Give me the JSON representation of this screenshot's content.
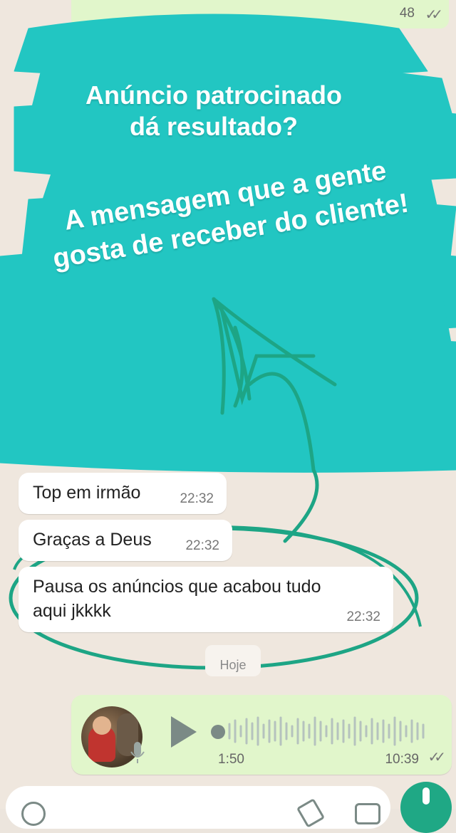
{
  "overlay": {
    "title_line1": "Anúncio patrocinado",
    "title_line2": "dá resultado?",
    "caption_line1": "A mensagem que a gente",
    "caption_line2": "gosta de receber do cliente!"
  },
  "top_message": {
    "time": "48",
    "ticks": "✓✓"
  },
  "messages": [
    {
      "text": "Top em irmão",
      "time": "22:32"
    },
    {
      "text": "Graças a Deus",
      "time": "22:32"
    },
    {
      "text_line1": "Pausa os anúncios que acabou tudo",
      "text_line2": "aqui jkkkk",
      "time": "22:32"
    }
  ],
  "date_chip": "Hoje",
  "voice_message": {
    "duration": "1:50",
    "time": "10:39",
    "ticks": "✓✓"
  },
  "colors": {
    "scribble": "#22c6c2",
    "ring": "#1da585",
    "outgoing": "#e1f6cb",
    "background": "#efe7de"
  }
}
